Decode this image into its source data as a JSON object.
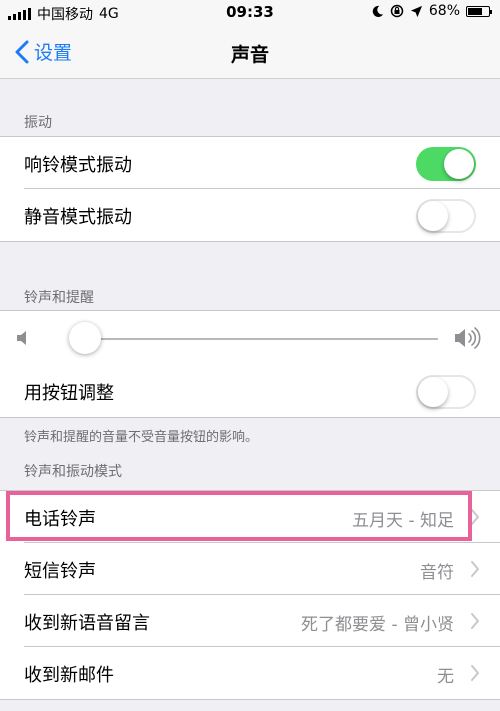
{
  "status_bar": {
    "carrier": "中国移动",
    "network": "4G",
    "time": "09:33",
    "battery": "68%",
    "battery_level": 0.68
  },
  "nav": {
    "back_label": "设置",
    "title": "声音"
  },
  "vibration": {
    "header": "振动",
    "ring_label": "响铃模式振动",
    "ring_on": true,
    "silent_label": "静音模式振动",
    "silent_on": false
  },
  "ringer": {
    "header": "铃声和提醒",
    "volume_level": 0.03,
    "buttons_label": "用按钮调整",
    "buttons_on": false,
    "footer": "铃声和提醒的音量不受音量按钮的影响。"
  },
  "patterns": {
    "header": "铃声和振动模式",
    "items": [
      {
        "label": "电话铃声",
        "value": "五月天 - 知足"
      },
      {
        "label": "短信铃声",
        "value": "音符"
      },
      {
        "label": "收到新语音留言",
        "value": "死了都要爱 - 曾小贤"
      },
      {
        "label": "收到新邮件",
        "value": "无"
      }
    ]
  },
  "colors": {
    "accent": "#1c7cf4",
    "toggle_on": "#4cd964",
    "highlight": "#e8629a"
  }
}
